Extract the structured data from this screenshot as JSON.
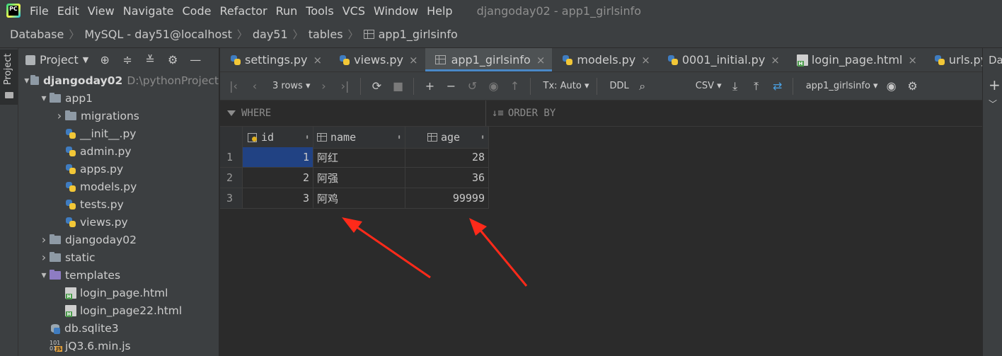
{
  "menu": {
    "items": [
      "File",
      "Edit",
      "View",
      "Navigate",
      "Code",
      "Refactor",
      "Run",
      "Tools",
      "VCS",
      "Window",
      "Help"
    ],
    "window_title": "djangoday02 - app1_girlsinfo",
    "logo_text": "PC"
  },
  "breadcrumb": [
    "Database",
    "MySQL - day51@localhost",
    "day51",
    "tables",
    "app1_girlsinfo"
  ],
  "left_strip": {
    "label": "Project"
  },
  "project_panel": {
    "title": "Project",
    "tree": [
      {
        "label": "djangoday02",
        "path": "D:\\pythonProject",
        "level": 0,
        "type": "folder",
        "expanded": true
      },
      {
        "label": "app1",
        "level": 1,
        "type": "folder",
        "expanded": true
      },
      {
        "label": "migrations",
        "level": 2,
        "type": "folder",
        "expanded": false
      },
      {
        "label": "__init__.py",
        "level": 2,
        "type": "py"
      },
      {
        "label": "admin.py",
        "level": 2,
        "type": "py"
      },
      {
        "label": "apps.py",
        "level": 2,
        "type": "py"
      },
      {
        "label": "models.py",
        "level": 2,
        "type": "py"
      },
      {
        "label": "tests.py",
        "level": 2,
        "type": "py"
      },
      {
        "label": "views.py",
        "level": 2,
        "type": "py"
      },
      {
        "label": "djangoday02",
        "level": 1,
        "type": "folder",
        "expanded": false
      },
      {
        "label": "static",
        "level": 1,
        "type": "folder",
        "expanded": false
      },
      {
        "label": "templates",
        "level": 1,
        "type": "folder-purple",
        "expanded": true
      },
      {
        "label": "login_page.html",
        "level": 2,
        "type": "html"
      },
      {
        "label": "login_page22.html",
        "level": 2,
        "type": "html"
      },
      {
        "label": "db.sqlite3",
        "level": 1,
        "type": "db"
      },
      {
        "label": "jQ3.6.min.js",
        "level": 1,
        "type": "js"
      }
    ]
  },
  "tabs": [
    {
      "label": "settings.py",
      "icon": "py",
      "active": false,
      "closable": true
    },
    {
      "label": "views.py",
      "icon": "py",
      "active": false,
      "closable": true
    },
    {
      "label": "app1_girlsinfo",
      "icon": "table",
      "active": true,
      "closable": true
    },
    {
      "label": "models.py",
      "icon": "py",
      "active": false,
      "closable": true
    },
    {
      "label": "0001_initial.py",
      "icon": "py",
      "active": false,
      "closable": true
    },
    {
      "label": "login_page.html",
      "icon": "html",
      "active": false,
      "closable": true
    },
    {
      "label": "urls.py",
      "icon": "py",
      "active": false,
      "closable": true
    }
  ],
  "right_panel": {
    "label": "Da"
  },
  "toolbar": {
    "rows": "3 rows",
    "tx": "Tx: Auto",
    "ddl": "DDL",
    "format": "CSV",
    "table": "app1_girlsinfo"
  },
  "filter": {
    "where": "WHERE",
    "order_by": "ORDER BY"
  },
  "grid": {
    "columns": [
      "id",
      "name",
      "age"
    ],
    "rows": [
      {
        "num": "1",
        "id": "1",
        "name": "阿红",
        "age": "28"
      },
      {
        "num": "2",
        "id": "2",
        "name": "阿强",
        "age": "36"
      },
      {
        "num": "3",
        "id": "3",
        "name": "阿鸡",
        "age": "99999"
      }
    ]
  },
  "colors": {
    "accent": "#4a88c7",
    "selection": "#214283",
    "annotation_arrow": "#ff2a1a"
  }
}
